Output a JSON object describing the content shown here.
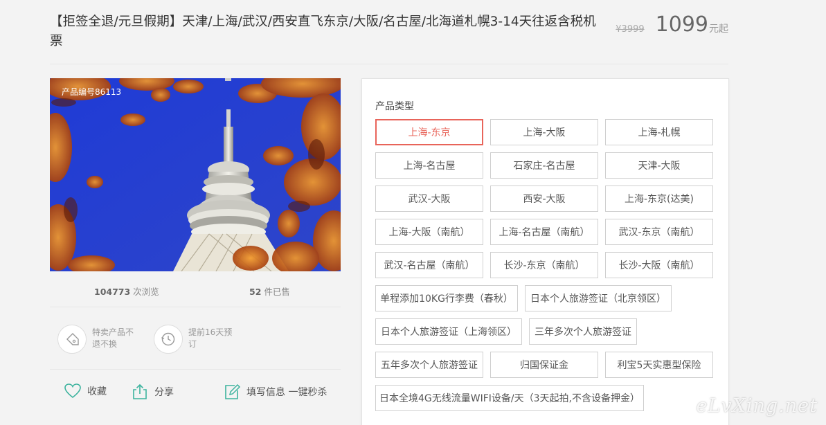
{
  "product": {
    "title": "【拒签全退/元旦假期】天津/上海/武汉/西安直飞东京/大阪/名古屋/北海道札幌3-14天往返含税机票",
    "old_price": "¥3999",
    "price": "1099",
    "price_unit": "元起",
    "code": "产品编号86113"
  },
  "stats": {
    "views_count": "104773",
    "views_label": " 次浏览",
    "sold_count": "52",
    "sold_label": " 件已售"
  },
  "features": [
    {
      "icon": "tag-icon",
      "text": "特卖产品不退不换"
    },
    {
      "icon": "clock-icon",
      "text": "提前16天预订"
    }
  ],
  "actions": {
    "favorite": "收藏",
    "share": "分享",
    "fill_info": "填写信息 一键秒杀"
  },
  "options_panel": {
    "label": "产品类型",
    "selected": "上海-东京",
    "options": [
      "上海-东京",
      "上海-大阪",
      "上海-札幌",
      "上海-名古屋",
      "石家庄-名古屋",
      "天津-大阪",
      "武汉-大阪",
      "西安-大阪",
      "上海-东京(达美)",
      "上海-大阪（南航）",
      "上海-名古屋（南航）",
      "武汉-东京（南航）",
      "武汉-名古屋（南航）",
      "长沙-东京（南航）",
      "长沙-大阪（南航）",
      "单程添加10KG行李费（春秋）",
      "日本个人旅游签证（北京领区）",
      "日本个人旅游签证（上海领区）",
      "三年多次个人旅游签证",
      "五年多次个人旅游签证",
      "归国保证金",
      "利宝5天实惠型保险",
      "日本全境4G无线流量WIFI设备/天（3天起拍,不含设备押金）"
    ]
  },
  "watermark": "eLvXing.net",
  "colors": {
    "accent": "#e8645a",
    "icon_green": "#3db39e",
    "sky": "#2b3fd4"
  }
}
